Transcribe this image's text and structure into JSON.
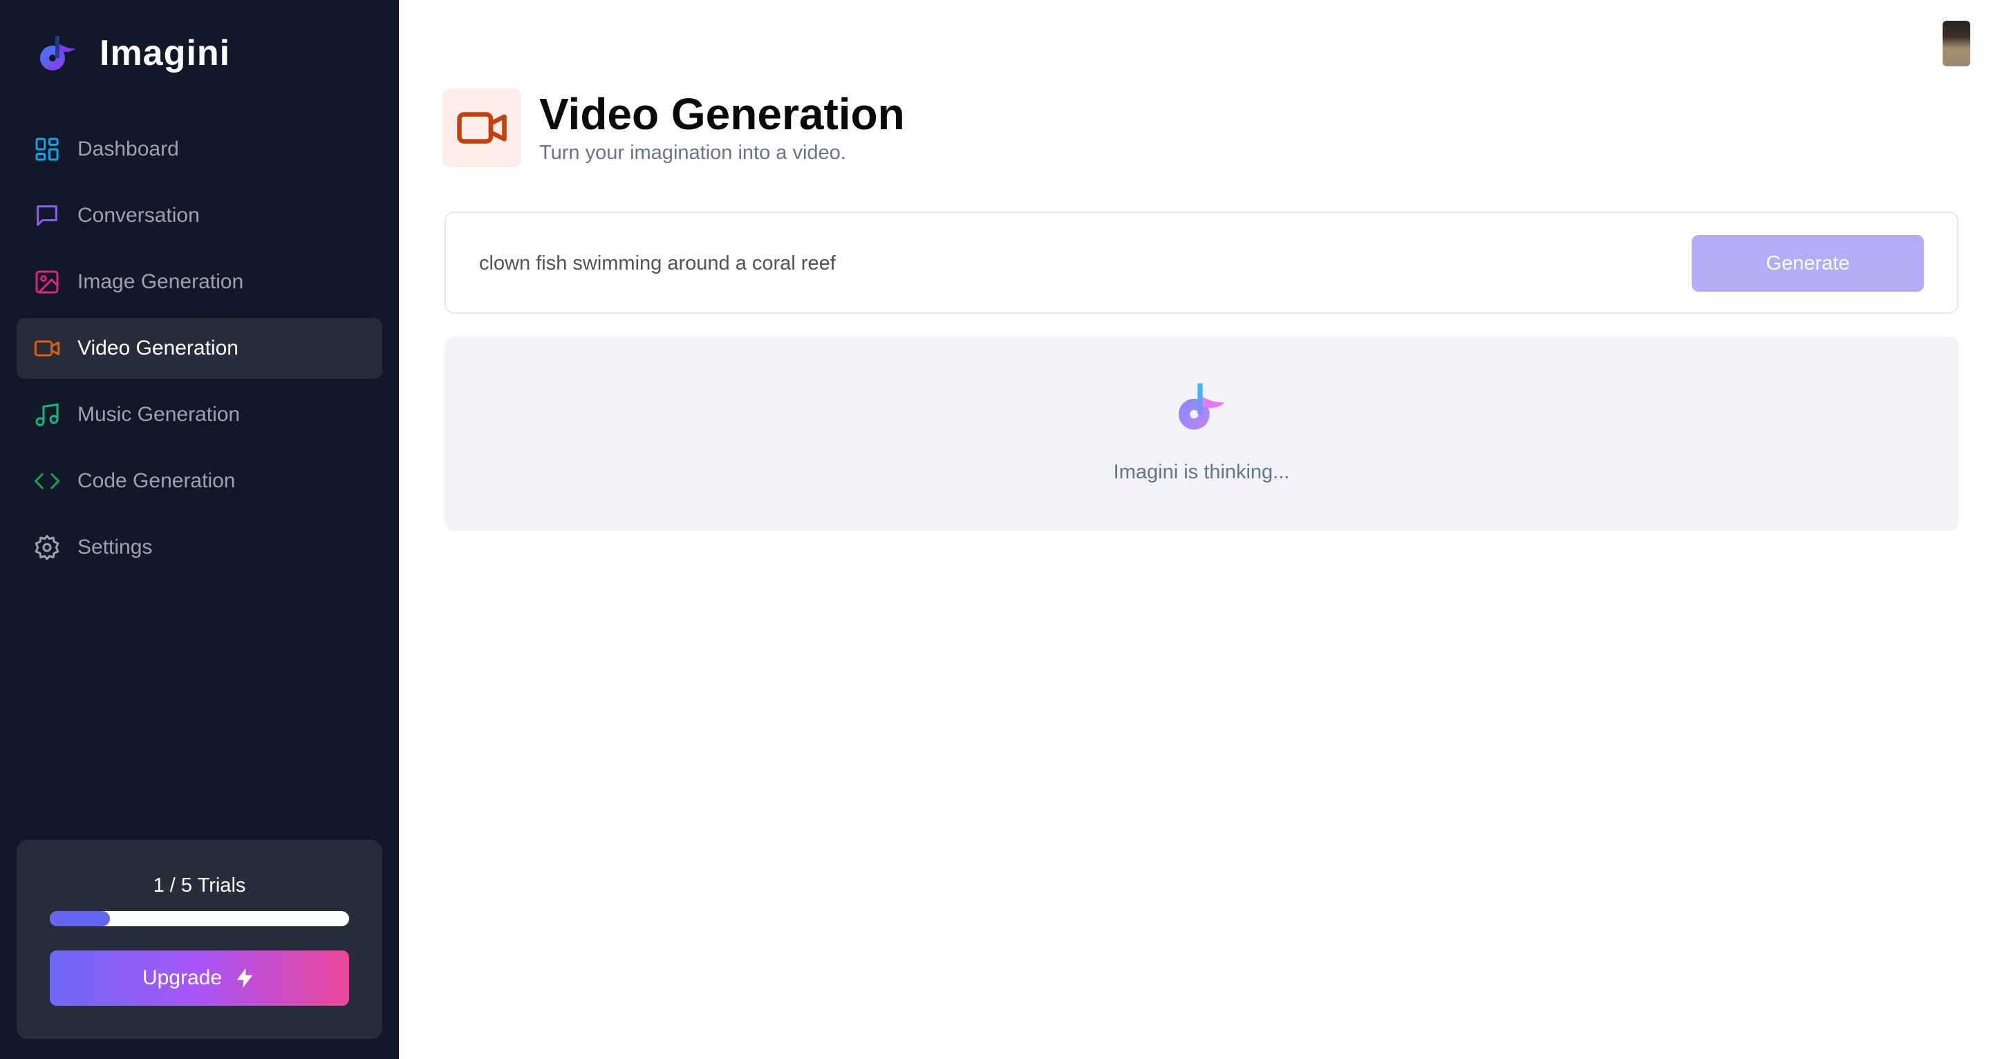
{
  "app": {
    "name": "Imagini"
  },
  "sidebar": {
    "items": [
      {
        "label": "Dashboard",
        "icon": "dashboard-icon",
        "color": "#0ea5e9"
      },
      {
        "label": "Conversation",
        "icon": "chat-icon",
        "color": "#8b5cf6"
      },
      {
        "label": "Image Generation",
        "icon": "image-icon",
        "color": "#db2777"
      },
      {
        "label": "Video Generation",
        "icon": "video-icon",
        "color": "#ea580c",
        "active": true
      },
      {
        "label": "Music Generation",
        "icon": "music-icon",
        "color": "#10b981"
      },
      {
        "label": "Code Generation",
        "icon": "code-icon",
        "color": "#16a34a"
      },
      {
        "label": "Settings",
        "icon": "gear-icon",
        "color": "#a1a1aa"
      }
    ],
    "trial": {
      "label": "1 / 5 Trials",
      "used": 1,
      "total": 5,
      "fraction": 0.2
    },
    "upgrade_label": "Upgrade"
  },
  "header": {
    "title": "Video Generation",
    "subtitle": "Turn your imagination into a video.",
    "icon": "video-icon",
    "icon_color": "#c2410c",
    "icon_bg": "#fbeee8"
  },
  "prompt": {
    "value": "clown fish swimming around a coral reef",
    "generate_label": "Generate"
  },
  "status": {
    "text": "Imagini is thinking..."
  },
  "colors": {
    "sidebar_bg": "#111827",
    "accent": "#6366f1",
    "generate_disabled": "#b3adf8"
  }
}
